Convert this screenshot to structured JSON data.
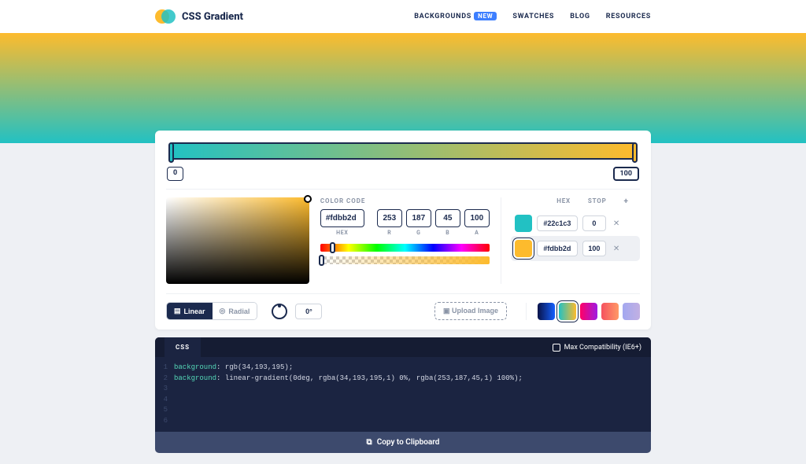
{
  "header": {
    "brand": "CSS Gradient",
    "nav": {
      "backgrounds": "BACKGROUNDS",
      "backgrounds_badge": "NEW",
      "swatches": "SWATCHES",
      "blog": "BLOG",
      "resources": "RESOURCES"
    }
  },
  "ruler": {
    "min": "0",
    "max": "100"
  },
  "color_code": {
    "label": "COLOR CODE",
    "hex": "#fdbb2d",
    "r": "253",
    "g": "187",
    "b": "45",
    "a": "100",
    "sub_hex": "HEX",
    "sub_r": "R",
    "sub_g": "G",
    "sub_b": "B",
    "sub_a": "A"
  },
  "stops_header": {
    "hex": "HEX",
    "stop": "STOP"
  },
  "stops": [
    {
      "color": "#22c1c3",
      "hex": "#22c1c3",
      "stop": "0",
      "active": false
    },
    {
      "color": "#fdbb2d",
      "hex": "#fdbb2d",
      "stop": "100",
      "active": true
    }
  ],
  "type": {
    "linear": "Linear",
    "radial": "Radial"
  },
  "angle": "0°",
  "upload": "Upload Image",
  "presets": [
    {
      "bg": "linear-gradient(90deg,#091248,#1560ff)",
      "active": false
    },
    {
      "bg": "linear-gradient(90deg,#22c1c3,#fdbb2d)",
      "active": true
    },
    {
      "bg": "linear-gradient(90deg,#f06,#9f1ae2)",
      "active": false
    },
    {
      "bg": "linear-gradient(90deg,#f5515f,#ff9966)",
      "active": false
    },
    {
      "bg": "linear-gradient(90deg,#a3a8f0,#c2b0e2)",
      "active": false
    }
  ],
  "code": {
    "tab": "CSS",
    "max_compat": "Max Compatibility (IE6+)",
    "lines": [
      "background: rgb(34,193,195);",
      "background: linear-gradient(0deg, rgba(34,193,195,1) 0%, rgba(253,187,45,1) 100%);",
      "",
      "",
      "",
      ""
    ],
    "copy": "Copy to Clipboard"
  }
}
